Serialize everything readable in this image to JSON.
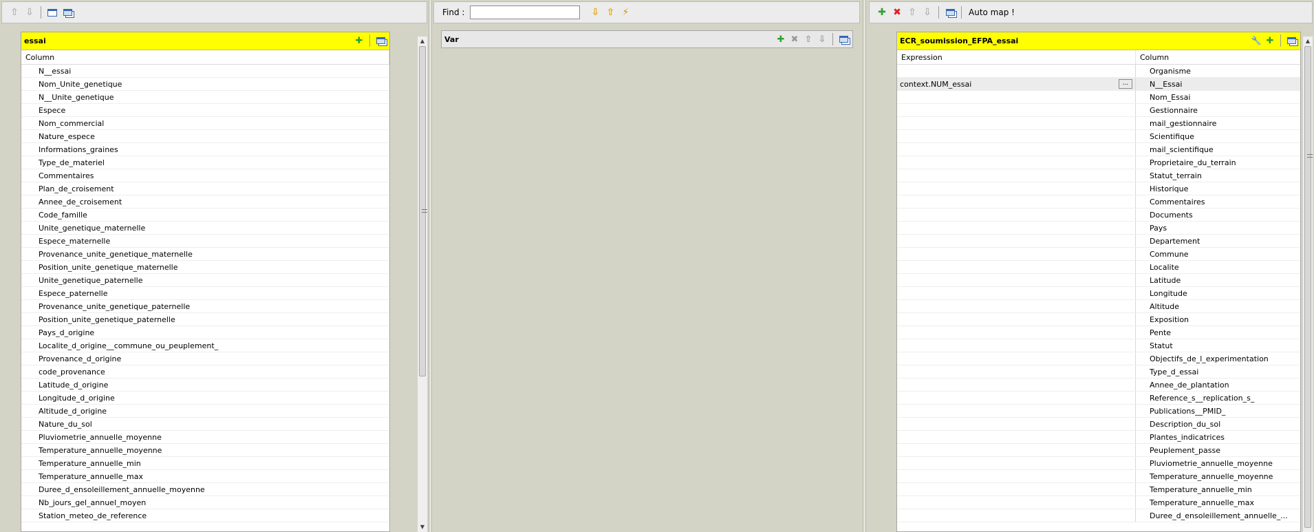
{
  "left": {
    "table_title": "essai",
    "column_header": "Column",
    "rows": [
      "N__essai",
      "Nom_Unite_genetique",
      "N__Unite_genetique",
      "Espece",
      "Nom_commercial",
      "Nature_espece",
      "Informations_graines",
      "Type_de_materiel",
      "Commentaires",
      "Plan_de_croisement",
      "Annee_de_croisement",
      "Code_famille",
      "Unite_genetique_maternelle",
      "Espece_maternelle",
      "Provenance_unite_genetique_maternelle",
      "Position_unite_genetique_maternelle",
      "Unite_genetique_paternelle",
      "Espece_paternelle",
      "Provenance_unite_genetique_paternelle",
      "Position_unite_genetique_paternelle",
      "Pays_d_origine",
      "Localite_d_origine__commune_ou_peuplement_",
      "Provenance_d_origine",
      "code_provenance",
      "Latitude_d_origine",
      "Longitude_d_origine",
      "Altitude_d_origine",
      "Nature_du_sol",
      "Pluviometrie_annuelle_moyenne",
      "Temperature_annuelle_moyenne",
      "Temperature_annuelle_min",
      "Temperature_annuelle_max",
      "Duree_d_ensoleillement_annuelle_moyenne",
      "Nb_jours_gel_annuel_moyen",
      "Station_meteo_de_reference"
    ]
  },
  "middle": {
    "find_label": "Find :",
    "find_value": "",
    "table_title": "Var"
  },
  "right": {
    "auto_map_label": "Auto map !",
    "table_title": "ECR_soumission_EFPA_essai",
    "expression_header": "Expression",
    "column_header": "Column",
    "ellipsis_label": "...",
    "rows": [
      {
        "expression": "",
        "column": "Organisme"
      },
      {
        "expression": "context.NUM_essai",
        "column": "N__Essai"
      },
      {
        "expression": "",
        "column": "Nom_Essai"
      },
      {
        "expression": "",
        "column": "Gestionnaire"
      },
      {
        "expression": "",
        "column": "mail_gestionnaire"
      },
      {
        "expression": "",
        "column": "Scientifique"
      },
      {
        "expression": "",
        "column": "mail_scientifique"
      },
      {
        "expression": "",
        "column": "Proprietaire_du_terrain"
      },
      {
        "expression": "",
        "column": "Statut_terrain"
      },
      {
        "expression": "",
        "column": "Historique"
      },
      {
        "expression": "",
        "column": "Commentaires"
      },
      {
        "expression": "",
        "column": "Documents"
      },
      {
        "expression": "",
        "column": "Pays"
      },
      {
        "expression": "",
        "column": "Departement"
      },
      {
        "expression": "",
        "column": "Commune"
      },
      {
        "expression": "",
        "column": "Localite"
      },
      {
        "expression": "",
        "column": "Latitude"
      },
      {
        "expression": "",
        "column": "Longitude"
      },
      {
        "expression": "",
        "column": "Altitude"
      },
      {
        "expression": "",
        "column": "Exposition"
      },
      {
        "expression": "",
        "column": "Pente"
      },
      {
        "expression": "",
        "column": "Statut"
      },
      {
        "expression": "",
        "column": "Objectifs_de_l_experimentation"
      },
      {
        "expression": "",
        "column": "Type_d_essai"
      },
      {
        "expression": "",
        "column": "Annee_de_plantation"
      },
      {
        "expression": "",
        "column": "Reference_s__replication_s_"
      },
      {
        "expression": "",
        "column": "Publications__PMID_"
      },
      {
        "expression": "",
        "column": "Description_du_sol"
      },
      {
        "expression": "",
        "column": "Plantes_indicatrices"
      },
      {
        "expression": "",
        "column": "Peuplement_passe"
      },
      {
        "expression": "",
        "column": "Pluviometrie_annuelle_moyenne"
      },
      {
        "expression": "",
        "column": "Temperature_annuelle_moyenne"
      },
      {
        "expression": "",
        "column": "Temperature_annuelle_min"
      },
      {
        "expression": "",
        "column": "Temperature_annuelle_max"
      },
      {
        "expression": "",
        "column": "Duree_d_ensoleillement_annuelle_..."
      }
    ]
  }
}
